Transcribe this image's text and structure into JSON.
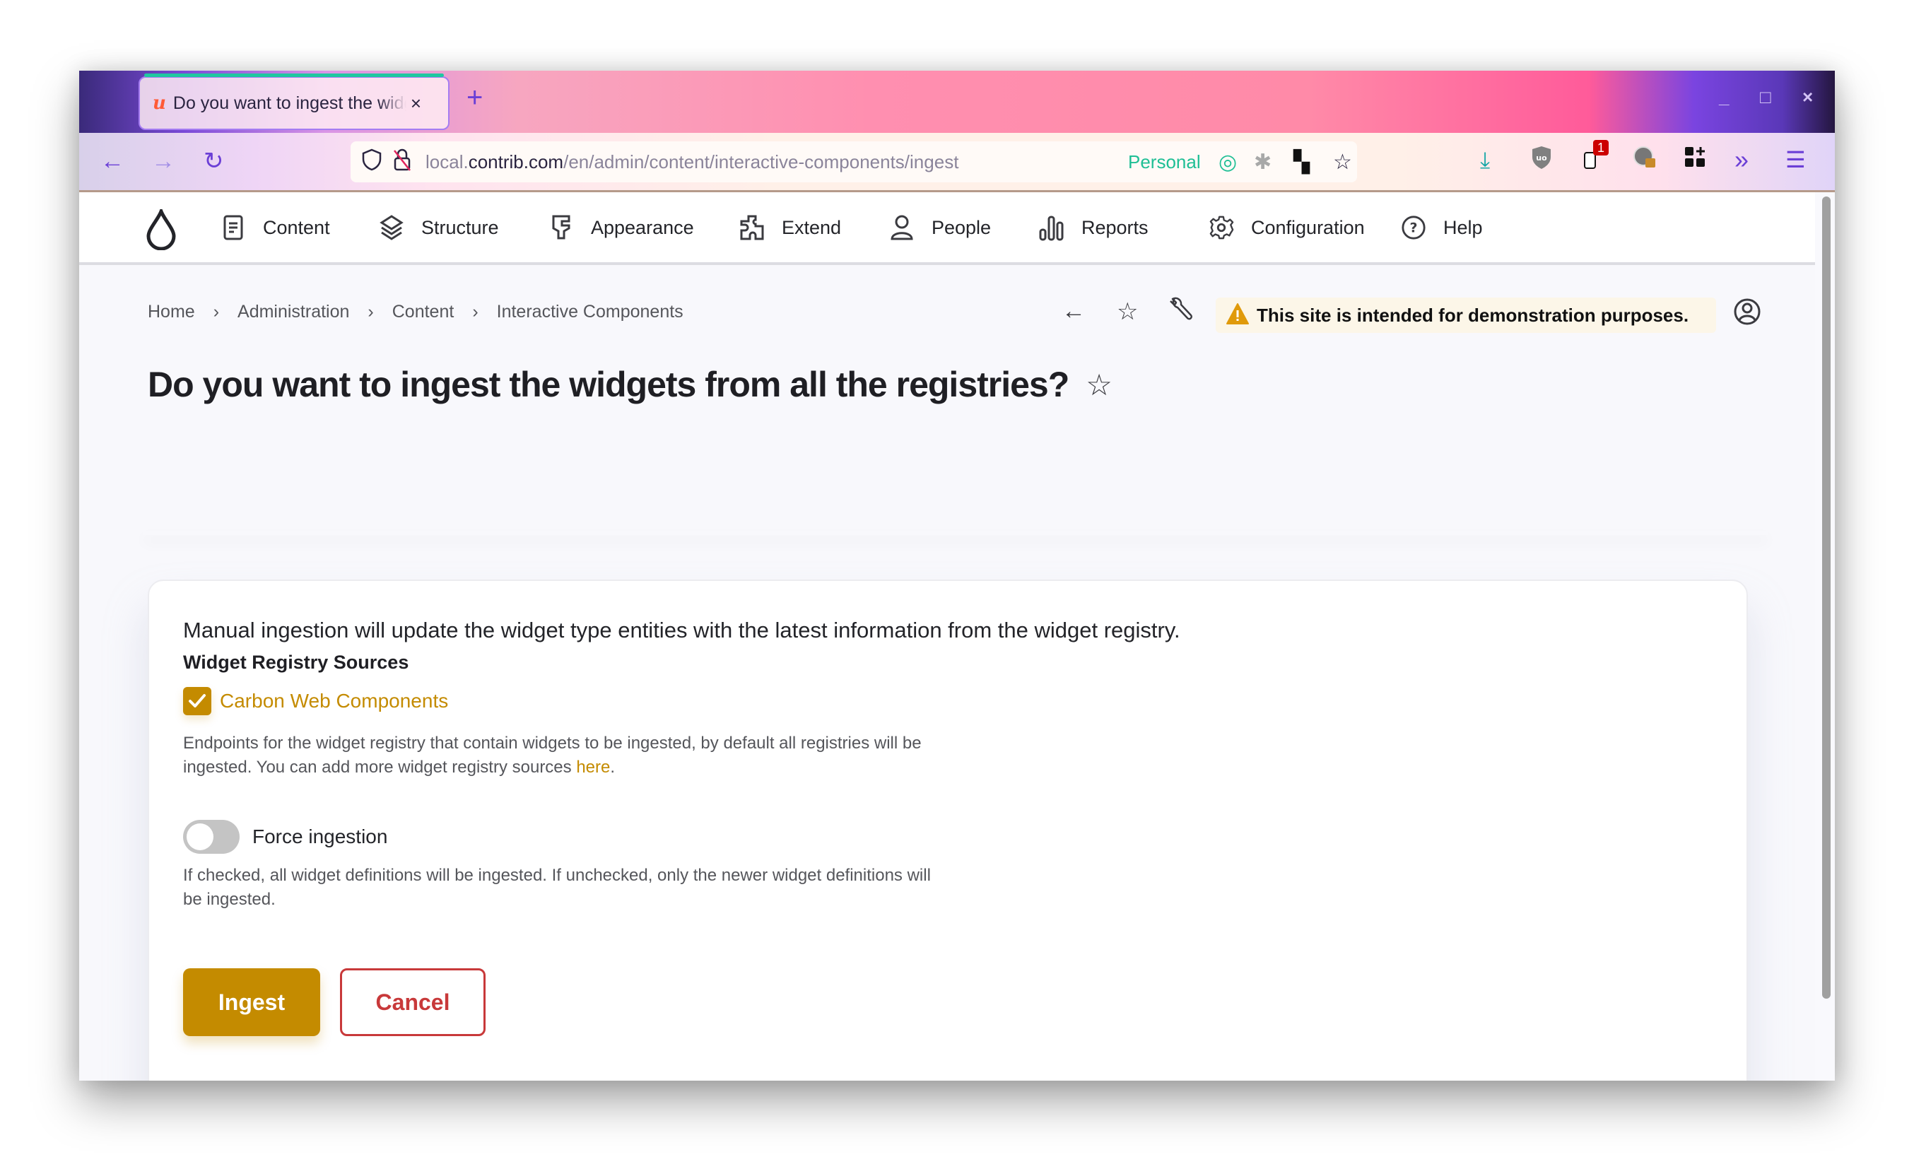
{
  "browser": {
    "tab": {
      "title": "Do you want to ingest the widgets from all the registries?",
      "close": "×"
    },
    "new_tab": "+",
    "window_controls": {
      "minimize": "_",
      "maximize": "□",
      "close": "×"
    },
    "nav": {
      "back": "←",
      "forward": "→",
      "reload": "↻"
    },
    "url": {
      "prefix": "local.",
      "host": "contrib.com",
      "path": "/en/admin/content/interactive-components/ingest"
    },
    "container": "Personal",
    "extension_badge": "1",
    "colors": {
      "accent": "#6b3fd6",
      "container": "#1fbf95"
    }
  },
  "nav": {
    "items": [
      {
        "label": "Content",
        "icon": "document-icon"
      },
      {
        "label": "Structure",
        "icon": "layers-icon"
      },
      {
        "label": "Appearance",
        "icon": "paintbrush-icon"
      },
      {
        "label": "Extend",
        "icon": "puzzle-icon"
      },
      {
        "label": "People",
        "icon": "person-icon"
      },
      {
        "label": "Reports",
        "icon": "bar-chart-icon"
      },
      {
        "label": "Configuration",
        "icon": "gear-icon"
      },
      {
        "label": "Help",
        "icon": "help-icon"
      }
    ]
  },
  "breadcrumb": {
    "items": [
      "Home",
      "Administration",
      "Content",
      "Interactive Components"
    ],
    "separator": "›"
  },
  "demo_banner": "This site is intended for demonstration purposes.",
  "page": {
    "title": "Do you want to ingest the widgets from all the registries?"
  },
  "form": {
    "intro": "Manual ingestion will update the widget type entities with the latest information from the widget registry.",
    "sources_label": "Widget Registry Sources",
    "source_checkbox": {
      "label": "Carbon Web Components",
      "checked": true
    },
    "sources_description": "Endpoints for the widget registry that contain widgets to be ingested, by default all registries will be ingested. You can add more widget registry sources ",
    "sources_link": "here",
    "sources_end": ".",
    "force_toggle": {
      "label": "Force ingestion",
      "checked": false
    },
    "force_description": "If checked, all widget definitions will be ingested. If unchecked, only the newer widget definitions will be ingested.",
    "submit_label": "Ingest",
    "cancel_label": "Cancel",
    "colors": {
      "primary": "#c48b00",
      "danger": "#c8393a"
    }
  }
}
